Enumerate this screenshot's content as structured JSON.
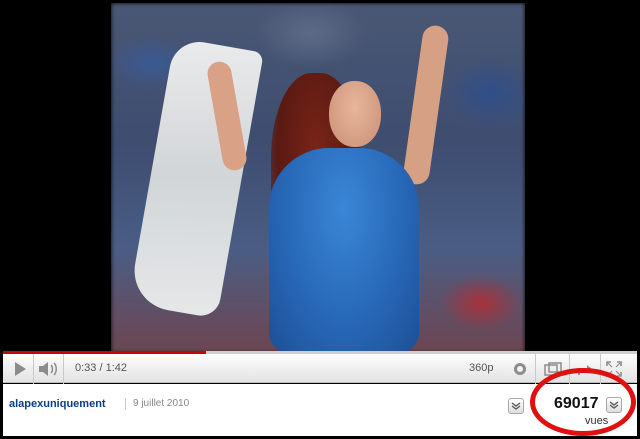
{
  "player": {
    "time_display": "0:33 / 1:42",
    "quality_label": "360p",
    "progress_fraction": 0.32
  },
  "video": {
    "icons": {
      "play": "play-icon",
      "volume": "volume-icon",
      "settings": "gear-icon",
      "popout": "popout-icon",
      "share": "share-icon",
      "fullscreen": "fullscreen-icon"
    }
  },
  "info": {
    "uploader": "alapexuniquement",
    "upload_date": "9 juillet 2010",
    "view_count": "69017",
    "views_label": "vues"
  },
  "colors": {
    "progress": "#c1070e",
    "uploader_link": "#0b3b8c",
    "highlight_circle": "#e01010"
  }
}
